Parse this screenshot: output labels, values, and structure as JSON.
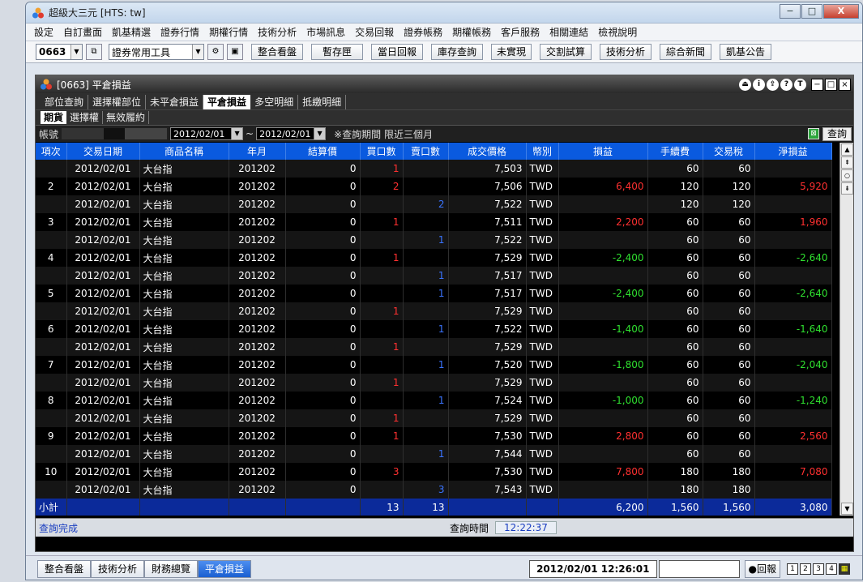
{
  "window": {
    "title": "超級大三元 [HTS: tw]",
    "buttons": [
      "−",
      "□",
      "X"
    ]
  },
  "menu": [
    "設定",
    "自訂畫面",
    "凱基精選",
    "證券行情",
    "期權行情",
    "技術分析",
    "市場訊息",
    "交易回報",
    "證券帳務",
    "期權帳務",
    "客戶服務",
    "相關連結",
    "檢視說明"
  ],
  "toolbar": {
    "code": "0663",
    "tool_select": "證券常用工具",
    "buttons": [
      "整合看盤",
      "暫存匣",
      "當日回報",
      "庫存查詢",
      "未實現",
      "交割試算",
      "技術分析",
      "綜合新聞",
      "凱基公告"
    ]
  },
  "inner_window": {
    "title": "[0663] 平倉損益",
    "title_icons": [
      "⏏",
      "i",
      "⇪",
      "?",
      "T"
    ]
  },
  "tabs": [
    "部位查詢",
    "選擇權部位",
    "未平倉損益",
    "平倉損益",
    "多空明細",
    "抵繳明細"
  ],
  "active_tab": "平倉損益",
  "subtabs": [
    "期貨",
    "選擇權",
    "無效履約"
  ],
  "active_subtab": "期貨",
  "filter": {
    "account_label": "帳號",
    "date_from": "2012/02/01",
    "tilde": "~",
    "date_to": "2012/02/01",
    "note": "※查詢期間 限近三個月",
    "query_button": "查詢"
  },
  "table": {
    "headers": [
      "項次",
      "交易日期",
      "商品名稱",
      "年月",
      "結算價",
      "買口數",
      "賣口數",
      "成交價格",
      "幣別",
      "損益",
      "手續費",
      "交易稅",
      "淨損益"
    ],
    "rows": [
      {
        "idx": "",
        "date": "2012/02/01",
        "name": "大台指",
        "ym": "201202",
        "settle": "0",
        "buy": "1",
        "sell": "",
        "price": "7,503",
        "cur": "TWD",
        "pl": "",
        "fee": "60",
        "tax": "60",
        "net": "",
        "pl_color": "",
        "net_color": ""
      },
      {
        "idx": "2",
        "date": "2012/02/01",
        "name": "大台指",
        "ym": "201202",
        "settle": "0",
        "buy": "2",
        "sell": "",
        "price": "7,506",
        "cur": "TWD",
        "pl": "6,400",
        "fee": "120",
        "tax": "120",
        "net": "5,920",
        "pl_color": "red",
        "net_color": "red"
      },
      {
        "idx": "",
        "date": "2012/02/01",
        "name": "大台指",
        "ym": "201202",
        "settle": "0",
        "buy": "",
        "sell": "2",
        "price": "7,522",
        "cur": "TWD",
        "pl": "",
        "fee": "120",
        "tax": "120",
        "net": "",
        "pl_color": "",
        "net_color": ""
      },
      {
        "idx": "3",
        "date": "2012/02/01",
        "name": "大台指",
        "ym": "201202",
        "settle": "0",
        "buy": "1",
        "sell": "",
        "price": "7,511",
        "cur": "TWD",
        "pl": "2,200",
        "fee": "60",
        "tax": "60",
        "net": "1,960",
        "pl_color": "red",
        "net_color": "red"
      },
      {
        "idx": "",
        "date": "2012/02/01",
        "name": "大台指",
        "ym": "201202",
        "settle": "0",
        "buy": "",
        "sell": "1",
        "price": "7,522",
        "cur": "TWD",
        "pl": "",
        "fee": "60",
        "tax": "60",
        "net": "",
        "pl_color": "",
        "net_color": ""
      },
      {
        "idx": "4",
        "date": "2012/02/01",
        "name": "大台指",
        "ym": "201202",
        "settle": "0",
        "buy": "1",
        "sell": "",
        "price": "7,529",
        "cur": "TWD",
        "pl": "-2,400",
        "fee": "60",
        "tax": "60",
        "net": "-2,640",
        "pl_color": "green",
        "net_color": "green"
      },
      {
        "idx": "",
        "date": "2012/02/01",
        "name": "大台指",
        "ym": "201202",
        "settle": "0",
        "buy": "",
        "sell": "1",
        "price": "7,517",
        "cur": "TWD",
        "pl": "",
        "fee": "60",
        "tax": "60",
        "net": "",
        "pl_color": "",
        "net_color": ""
      },
      {
        "idx": "5",
        "date": "2012/02/01",
        "name": "大台指",
        "ym": "201202",
        "settle": "0",
        "buy": "",
        "sell": "1",
        "price": "7,517",
        "cur": "TWD",
        "pl": "-2,400",
        "fee": "60",
        "tax": "60",
        "net": "-2,640",
        "pl_color": "green",
        "net_color": "green"
      },
      {
        "idx": "",
        "date": "2012/02/01",
        "name": "大台指",
        "ym": "201202",
        "settle": "0",
        "buy": "1",
        "sell": "",
        "price": "7,529",
        "cur": "TWD",
        "pl": "",
        "fee": "60",
        "tax": "60",
        "net": "",
        "pl_color": "",
        "net_color": ""
      },
      {
        "idx": "6",
        "date": "2012/02/01",
        "name": "大台指",
        "ym": "201202",
        "settle": "0",
        "buy": "",
        "sell": "1",
        "price": "7,522",
        "cur": "TWD",
        "pl": "-1,400",
        "fee": "60",
        "tax": "60",
        "net": "-1,640",
        "pl_color": "green",
        "net_color": "green"
      },
      {
        "idx": "",
        "date": "2012/02/01",
        "name": "大台指",
        "ym": "201202",
        "settle": "0",
        "buy": "1",
        "sell": "",
        "price": "7,529",
        "cur": "TWD",
        "pl": "",
        "fee": "60",
        "tax": "60",
        "net": "",
        "pl_color": "",
        "net_color": ""
      },
      {
        "idx": "7",
        "date": "2012/02/01",
        "name": "大台指",
        "ym": "201202",
        "settle": "0",
        "buy": "",
        "sell": "1",
        "price": "7,520",
        "cur": "TWD",
        "pl": "-1,800",
        "fee": "60",
        "tax": "60",
        "net": "-2,040",
        "pl_color": "green",
        "net_color": "green"
      },
      {
        "idx": "",
        "date": "2012/02/01",
        "name": "大台指",
        "ym": "201202",
        "settle": "0",
        "buy": "1",
        "sell": "",
        "price": "7,529",
        "cur": "TWD",
        "pl": "",
        "fee": "60",
        "tax": "60",
        "net": "",
        "pl_color": "",
        "net_color": ""
      },
      {
        "idx": "8",
        "date": "2012/02/01",
        "name": "大台指",
        "ym": "201202",
        "settle": "0",
        "buy": "",
        "sell": "1",
        "price": "7,524",
        "cur": "TWD",
        "pl": "-1,000",
        "fee": "60",
        "tax": "60",
        "net": "-1,240",
        "pl_color": "green",
        "net_color": "green"
      },
      {
        "idx": "",
        "date": "2012/02/01",
        "name": "大台指",
        "ym": "201202",
        "settle": "0",
        "buy": "1",
        "sell": "",
        "price": "7,529",
        "cur": "TWD",
        "pl": "",
        "fee": "60",
        "tax": "60",
        "net": "",
        "pl_color": "",
        "net_color": ""
      },
      {
        "idx": "9",
        "date": "2012/02/01",
        "name": "大台指",
        "ym": "201202",
        "settle": "0",
        "buy": "1",
        "sell": "",
        "price": "7,530",
        "cur": "TWD",
        "pl": "2,800",
        "fee": "60",
        "tax": "60",
        "net": "2,560",
        "pl_color": "red",
        "net_color": "red"
      },
      {
        "idx": "",
        "date": "2012/02/01",
        "name": "大台指",
        "ym": "201202",
        "settle": "0",
        "buy": "",
        "sell": "1",
        "price": "7,544",
        "cur": "TWD",
        "pl": "",
        "fee": "60",
        "tax": "60",
        "net": "",
        "pl_color": "",
        "net_color": ""
      },
      {
        "idx": "10",
        "date": "2012/02/01",
        "name": "大台指",
        "ym": "201202",
        "settle": "0",
        "buy": "3",
        "sell": "",
        "price": "7,530",
        "cur": "TWD",
        "pl": "7,800",
        "fee": "180",
        "tax": "180",
        "net": "7,080",
        "pl_color": "red",
        "net_color": "red"
      },
      {
        "idx": "",
        "date": "2012/02/01",
        "name": "大台指",
        "ym": "201202",
        "settle": "0",
        "buy": "",
        "sell": "3",
        "price": "7,543",
        "cur": "TWD",
        "pl": "",
        "fee": "180",
        "tax": "180",
        "net": "",
        "pl_color": "",
        "net_color": ""
      }
    ],
    "subtotal": {
      "label": "小計",
      "buy": "13",
      "sell": "13",
      "pl": "6,200",
      "fee": "1,560",
      "tax": "1,560",
      "net": "3,080"
    }
  },
  "status": {
    "message": "查詢完成",
    "time_label": "查詢時間",
    "time_value": "12:22:37"
  },
  "bottom": {
    "tabs": [
      "整合看盤",
      "技術分析",
      "財務總覽",
      "平倉損益"
    ],
    "active_tab": "平倉損益",
    "clock": "2012/02/01 12:26:01",
    "report_button": "●回報",
    "icons": [
      "1",
      "2",
      "3",
      "4"
    ]
  },
  "colors": {
    "header_blue": "#0a5adf",
    "subtotal_blue": "#0b2a9a",
    "profit_red": "#ff3030",
    "loss_green": "#2fe02f",
    "sell_blue": "#3a74ff"
  }
}
